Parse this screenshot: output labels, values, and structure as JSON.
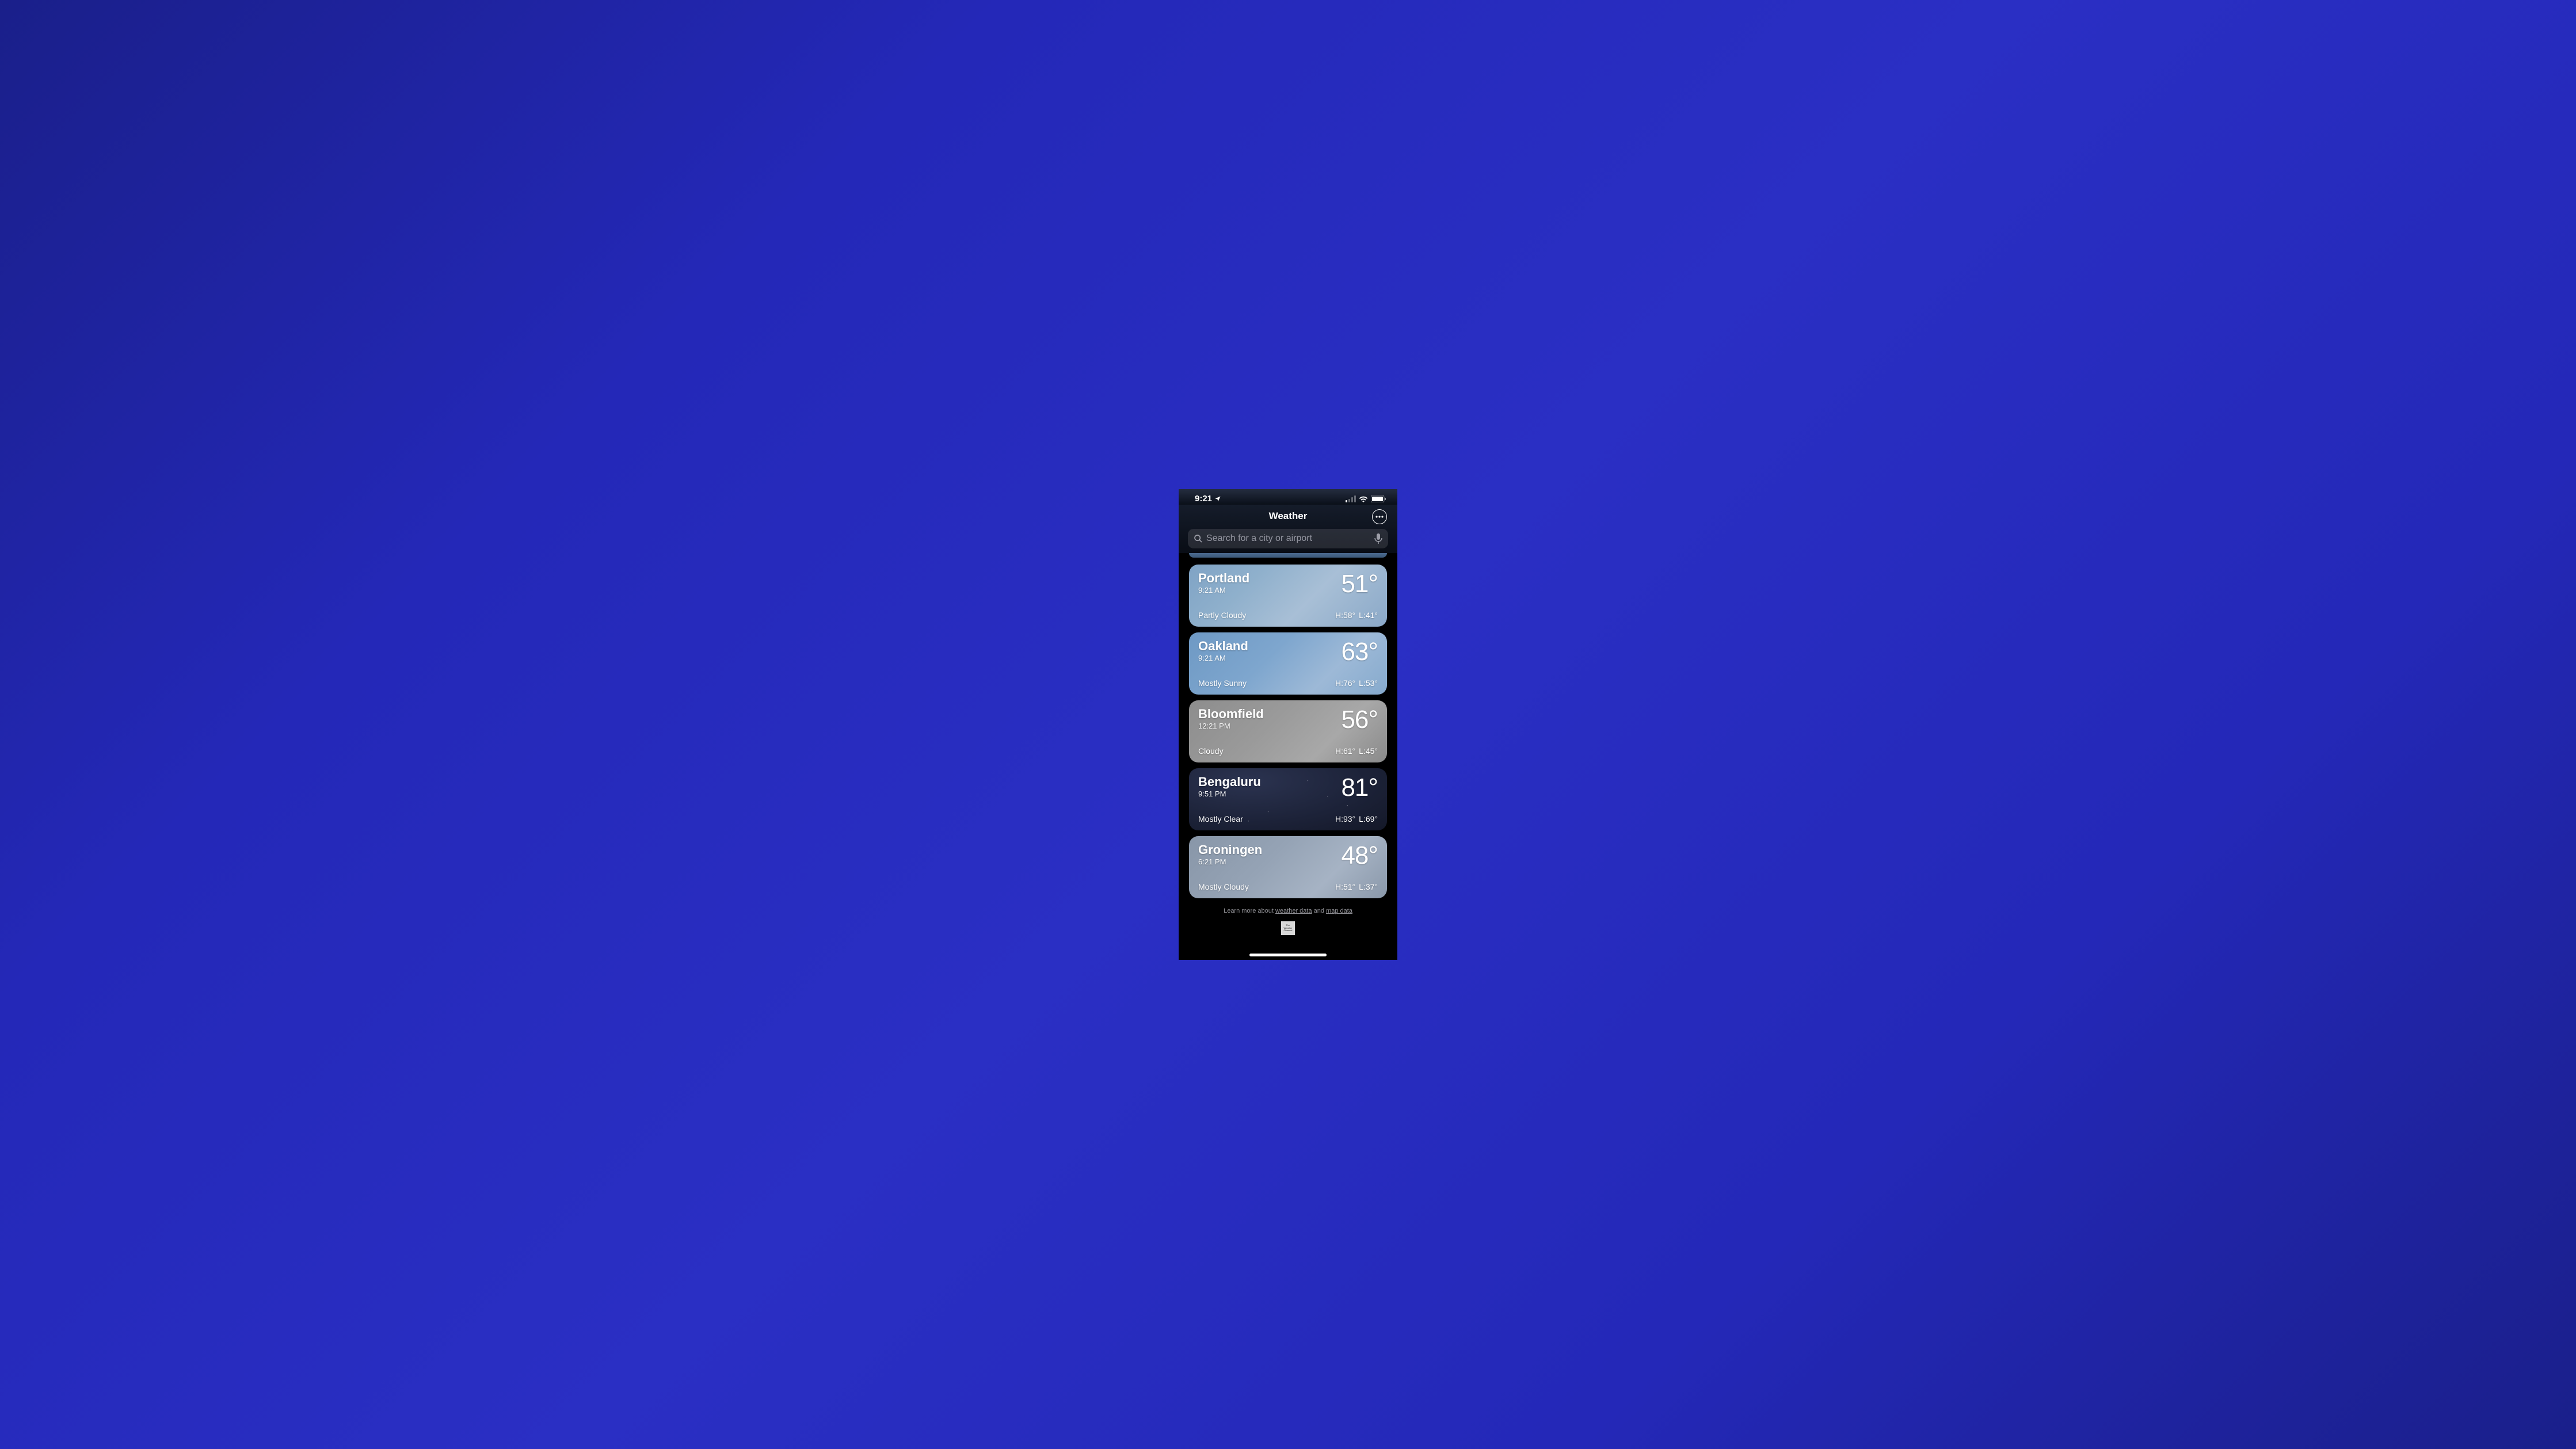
{
  "status": {
    "time": "9:21"
  },
  "header": {
    "title": "Weather"
  },
  "search": {
    "placeholder": "Search for a city or airport"
  },
  "cards": [
    {
      "city": "Portland",
      "time": "9:21 AM",
      "temp": "51°",
      "cond": "Partly Cloudy",
      "hi": "H:58°",
      "lo": "L:41°",
      "bg": "bg-partly"
    },
    {
      "city": "Oakland",
      "time": "9:21 AM",
      "temp": "63°",
      "cond": "Mostly Sunny",
      "hi": "H:76°",
      "lo": "L:53°",
      "bg": "bg-sunny"
    },
    {
      "city": "Bloomfield",
      "time": "12:21 PM",
      "temp": "56°",
      "cond": "Cloudy",
      "hi": "H:61°",
      "lo": "L:45°",
      "bg": "bg-cloudy"
    },
    {
      "city": "Bengaluru",
      "time": "9:51 PM",
      "temp": "81°",
      "cond": "Mostly Clear",
      "hi": "H:93°",
      "lo": "L:69°",
      "bg": "bg-night stars"
    },
    {
      "city": "Groningen",
      "time": "6:21 PM",
      "temp": "48°",
      "cond": "Mostly Cloudy",
      "hi": "H:51°",
      "lo": "L:37°",
      "bg": "bg-mcloud"
    }
  ],
  "footer": {
    "pre": "Learn more about ",
    "link1": "weather data",
    "mid": " and ",
    "link2": "map data",
    "badge": "The Weather Channel"
  }
}
